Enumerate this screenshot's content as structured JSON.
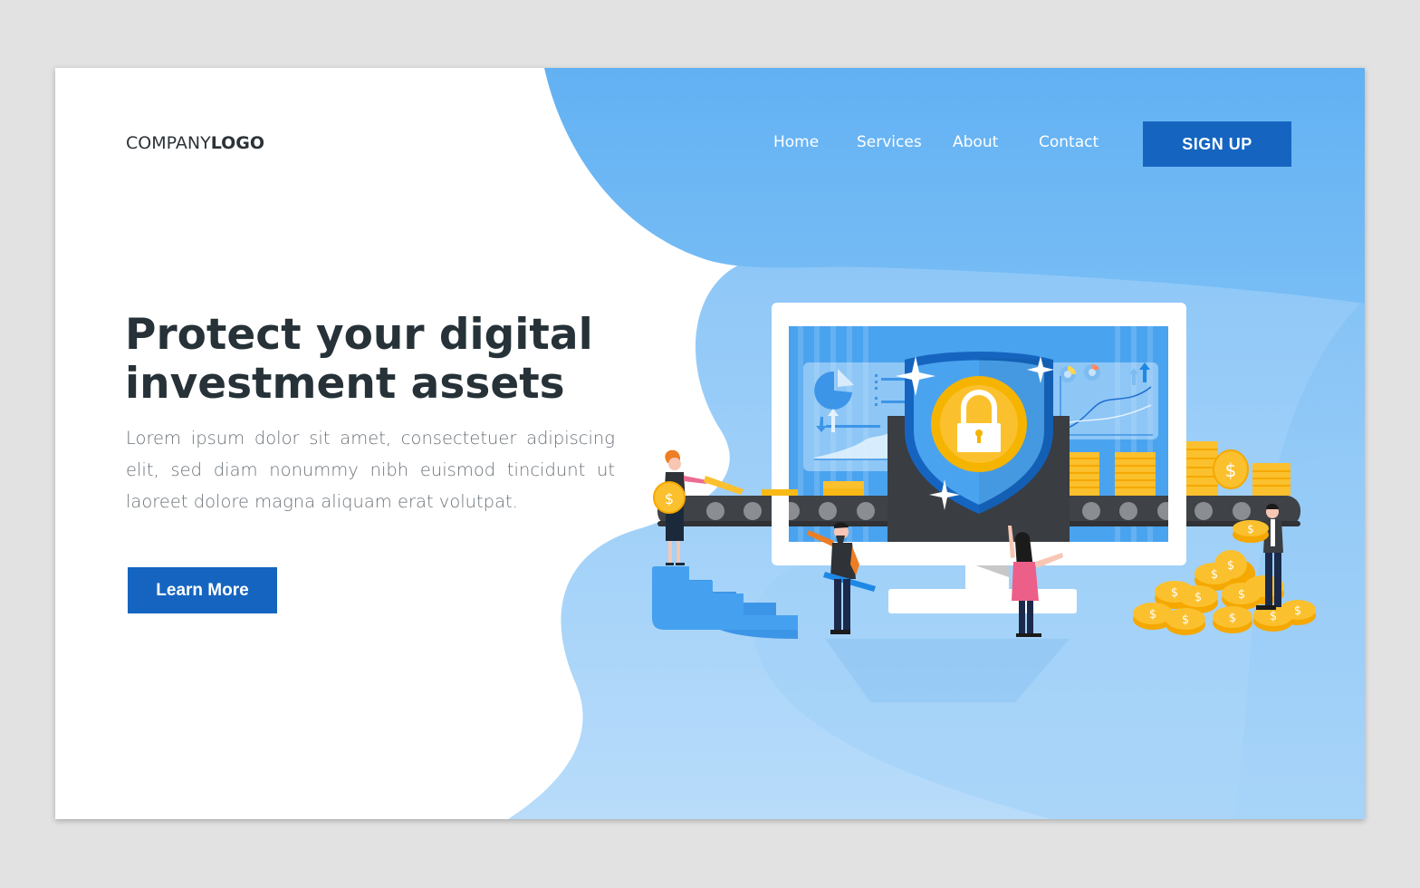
{
  "brand": {
    "logo_light": "COMPANY",
    "logo_bold": "LOGO"
  },
  "nav": {
    "items": [
      {
        "label": "Home"
      },
      {
        "label": "Services"
      },
      {
        "label": "About"
      },
      {
        "label": "Contact"
      }
    ],
    "signup_label": "SIGN UP"
  },
  "hero": {
    "headline_line1": "Protect your digital",
    "headline_line2": "investment assets",
    "body": "Lorem ipsum dolor sit amet, consectetuer adipiscing elit, sed diam nonummy nibh euismod tincidunt ut laoreet dolore magna aliquam erat volutpat.",
    "cta_label": "Learn More"
  },
  "illustration": {
    "subject": "digital asset security",
    "elements": [
      "monitor",
      "shield",
      "padlock",
      "conveyor-belt",
      "coin-stacks",
      "coin-pile",
      "stairs",
      "people"
    ]
  },
  "colors": {
    "primary": "#1565c0",
    "blob_dark": "#64b2f3",
    "blob_light": "#a8d3f8",
    "heading": "#263238",
    "body": "#6b7278",
    "coin": "#fbc02d",
    "shield": "#1e6fd0"
  }
}
